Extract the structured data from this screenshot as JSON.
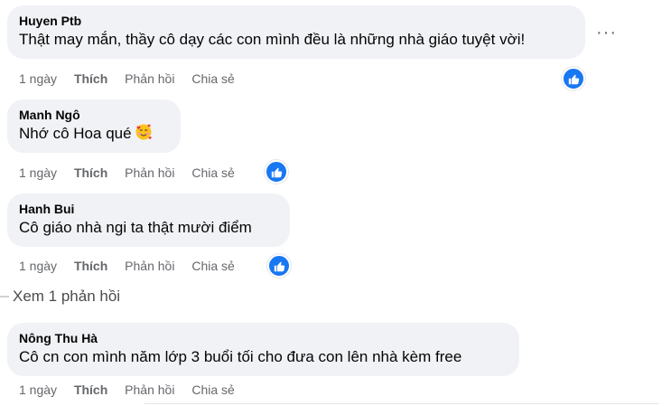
{
  "comments": [
    {
      "author": "Huyen Ptb",
      "text": "Thật may mắn, thầy cô dạy các con mình đều là những nhà giáo tuyệt vời!",
      "time": "1 ngày",
      "like": "Thích",
      "reply": "Phản hồi",
      "share": "Chia sẻ",
      "reaction": "like-icon"
    },
    {
      "author": "Manh Ngô",
      "text": "Nhớ cô Hoa qué",
      "emoji": "smiling-face-with-hearts-icon",
      "time": "1 ngày",
      "like": "Thích",
      "reply": "Phản hồi",
      "share": "Chia sẻ",
      "reaction": "like-icon"
    },
    {
      "author": "Hanh Bui",
      "text": "Cô giáo nhà ngi ta thật mười điểm",
      "time": "1 ngày",
      "like": "Thích",
      "reply": "Phản hồi",
      "share": "Chia sẻ",
      "reaction": "like-icon"
    },
    {
      "author": "Nông Thu Hà",
      "text": "Cô cn con mình năm lớp 3 buổi tối cho đưa con lên nhà kèm free",
      "time": "1 ngày",
      "like": "Thích",
      "reply": "Phản hồi",
      "share": "Chia sẻ"
    }
  ],
  "view_replies": "Xem 1 phản hồi",
  "more_menu": "···",
  "colors": {
    "bubble": "#f0f2f5",
    "meta": "#65676b",
    "like_blue": "#1877f2"
  }
}
